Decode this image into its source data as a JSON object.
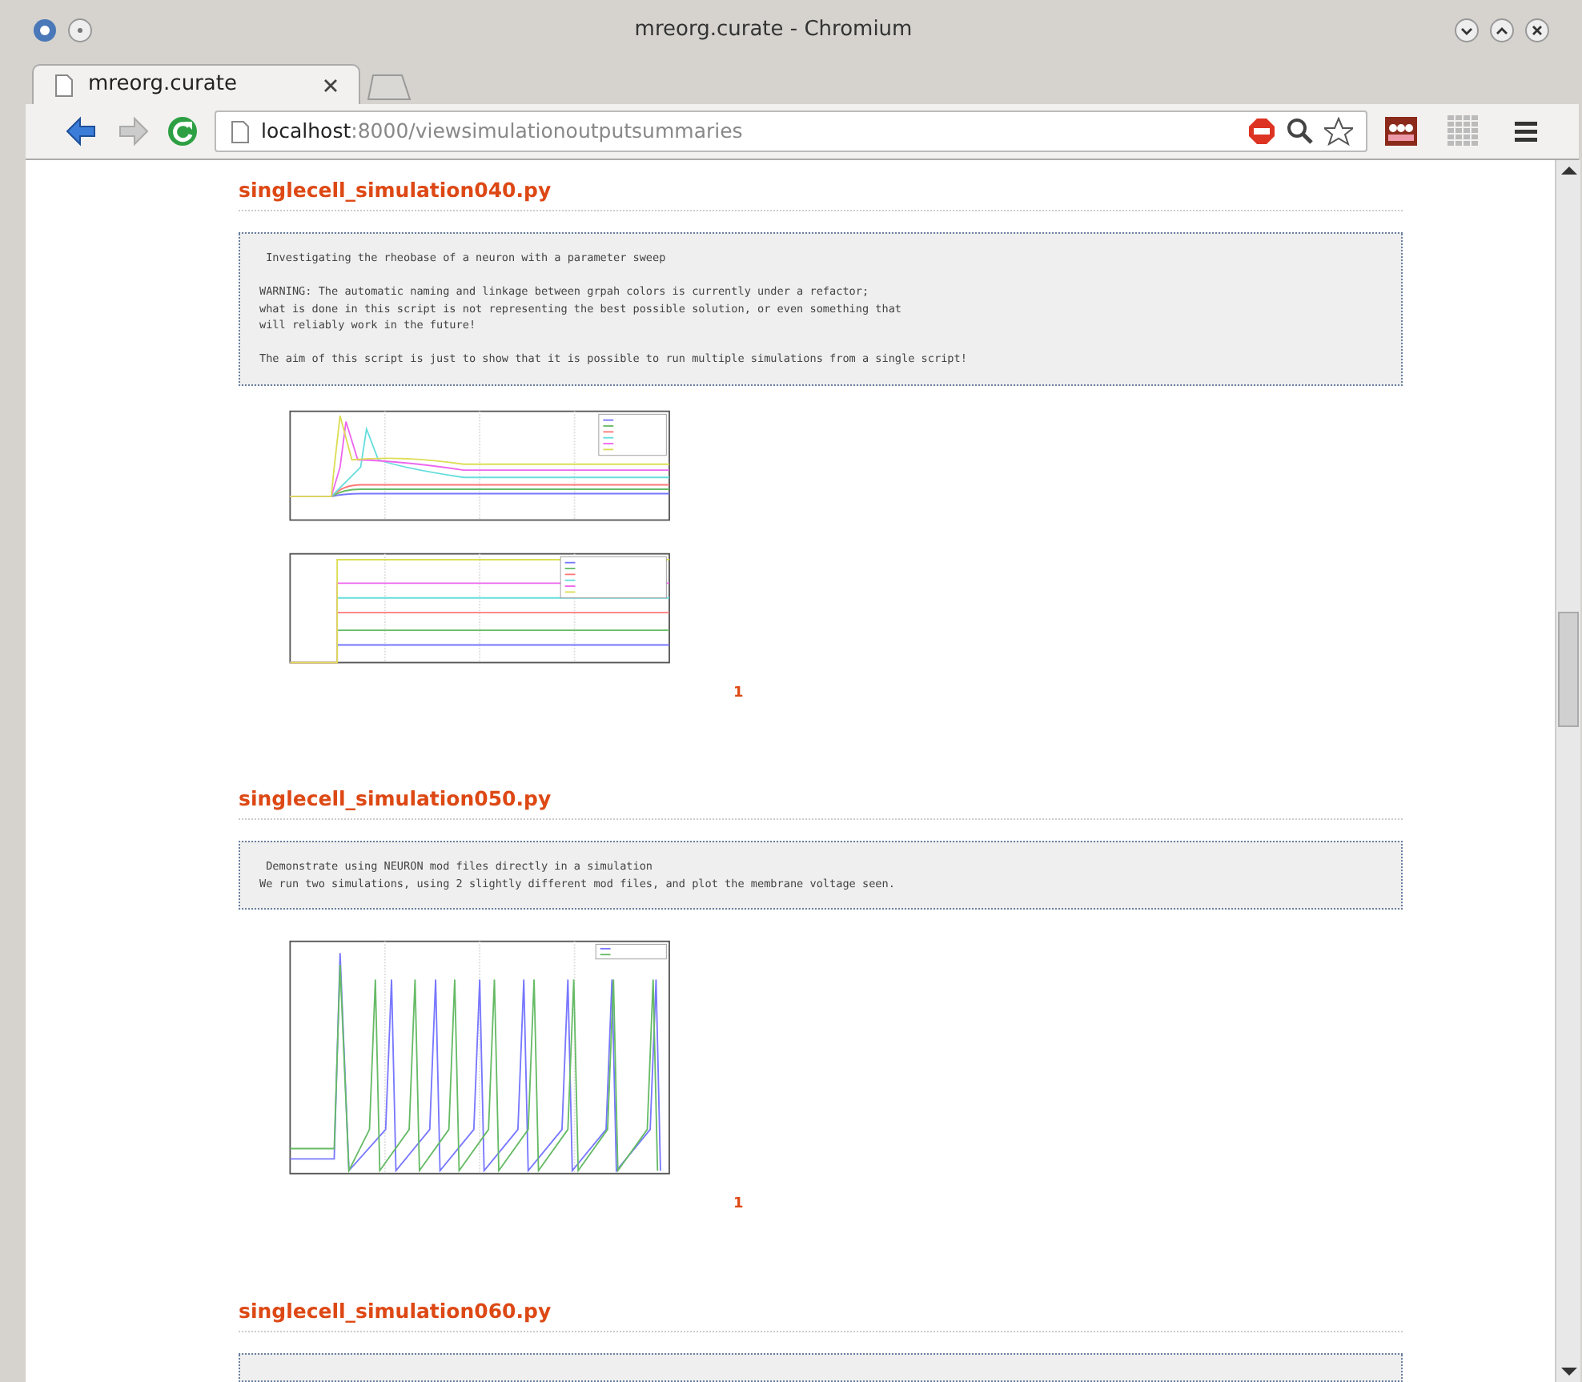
{
  "window": {
    "title": "mreorg.curate - Chromium"
  },
  "tabs": [
    {
      "label": "mreorg.curate",
      "selected": true
    }
  ],
  "address_bar": {
    "host": "localhost",
    "path": ":8000/viewsimulationoutputsummaries"
  },
  "sections": [
    {
      "filename": "singlecell_simulation040.py",
      "description": " Investigating the rheobase of a neuron with a parameter sweep\n\nWARNING: The automatic naming and linkage between grpah colors is currently under a refactor;\nwhat is done in this script is not representing the best possible solution, or even something that\nwill reliably work in the future!\n\nThe aim of this script is just to show that it is possible to run multiple simulations from a single script!",
      "plots": [
        {
          "kind": "voltage_sweep"
        },
        {
          "kind": "current_steps"
        }
      ],
      "page_link": "1"
    },
    {
      "filename": "singlecell_simulation050.py",
      "description": " Demonstrate using NEURON mod files directly in a simulation\nWe run two simulations, using 2 slightly different mod files, and plot the membrane voltage seen.",
      "plots": [
        {
          "kind": "spike_trains"
        }
      ],
      "page_link": "1"
    },
    {
      "filename": "singlecell_simulation060.py"
    }
  ]
}
